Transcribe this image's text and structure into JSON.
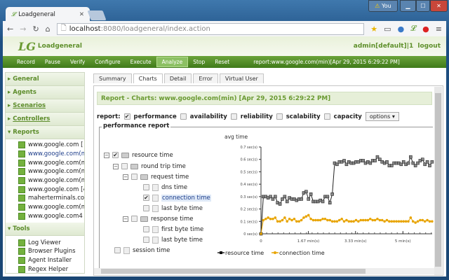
{
  "browser": {
    "tab_title": "Loadgeneral",
    "url_host": "localhost",
    "url_rest": ":8080/loadgeneral/index.action",
    "user_badge": "You"
  },
  "app": {
    "logo_text": "Loadgeneral",
    "user": "admin[default]|1",
    "logout": "logout"
  },
  "nav": {
    "items": [
      "Record",
      "Pause",
      "Verify",
      "Configure",
      "Execute",
      "Analyze",
      "Stop",
      "Reset"
    ],
    "active": "Analyze",
    "info": "report:www.google.com(min)[Apr 29, 2015 6:29:22 PM]"
  },
  "sidebar": {
    "sections": [
      {
        "label": "General"
      },
      {
        "label": "Agents"
      },
      {
        "label": "Scenarios"
      },
      {
        "label": "Controllers"
      },
      {
        "label": "Reports"
      },
      {
        "label": "Tools"
      }
    ],
    "reports": [
      "www.google.com [",
      "www.google.com(m",
      "www.google.com(m",
      "www.google.com(m",
      "www.google.com(m",
      "www.google.com [4",
      "maherterminals.co",
      "www.google.com(m",
      "www.google.com4"
    ],
    "tools": [
      "Log Viewer",
      "Browser Plugins",
      "Agent Installer",
      "Regex Helper"
    ]
  },
  "tabs": [
    "Summary",
    "Charts",
    "Detail",
    "Error",
    "Virtual User"
  ],
  "report_header": "Report - Charts: www.google.com(min) [Apr 29, 2015 6:29:22 PM]",
  "report_row": {
    "label": "report:",
    "types": [
      {
        "label": "performance",
        "checked": true
      },
      {
        "label": "availability",
        "checked": false
      },
      {
        "label": "reliability",
        "checked": false
      },
      {
        "label": "scalability",
        "checked": false
      },
      {
        "label": "capacity",
        "checked": false
      }
    ],
    "options": "options ▾"
  },
  "fieldset_label": "performance report",
  "tree": [
    "resource time",
    "round trip time",
    "request time",
    "dns time",
    "connection time",
    "last byte time",
    "response time",
    "first byte time",
    "last byte time",
    "session time"
  ],
  "chart_data": {
    "type": "line",
    "title": "avg time",
    "xlabel": "min(s)",
    "ylabel": "sec(s)",
    "xlim": [
      0,
      6.03
    ],
    "ylim": [
      0,
      0.7
    ],
    "x_ticks": [
      "0",
      "1.67 min(s)",
      "3.33 min(s)",
      "5 min(s)"
    ],
    "x_tick_values": [
      0,
      1.67,
      3.33,
      5
    ],
    "y_ticks": [
      "0 sec(s)",
      "0.1 sec(s)",
      "0.2 sec(s)",
      "0.3 sec(s)",
      "0.4 sec(s)",
      "0.5 sec(s)",
      "0.6 sec(s)",
      "0.7 sec(s)"
    ],
    "x_step": 0.0837,
    "legend": "bottom",
    "series": [
      {
        "name": "resource time",
        "color": "#222222",
        "marker_color": "#888888",
        "values": [
          0,
          0.3,
          0.3,
          0.29,
          0.3,
          0.28,
          0.3,
          0.25,
          0.24,
          0.28,
          0.3,
          0.26,
          0.29,
          0.28,
          0.28,
          0.27,
          0.28,
          0.28,
          0.33,
          0.34,
          0.28,
          0.32,
          0.26,
          0.26,
          0.26,
          0.27,
          0.26,
          0.3,
          0.3,
          0.25,
          0.32,
          0.57,
          0.56,
          0.58,
          0.58,
          0.59,
          0.56,
          0.58,
          0.57,
          0.57,
          0.58,
          0.58,
          0.59,
          0.59,
          0.57,
          0.58,
          0.57,
          0.59,
          0.59,
          0.62,
          0.6,
          0.58,
          0.57,
          0.58,
          0.55,
          0.55,
          0.57,
          0.57,
          0.57,
          0.56,
          0.58,
          0.56,
          0.57,
          0.62,
          0.57,
          0.55,
          0.57,
          0.59,
          0.6,
          0.56,
          0.58,
          0.55,
          0.58
        ]
      },
      {
        "name": "connection time",
        "color": "#e8a400",
        "marker_color": "#e8a400",
        "values": [
          0,
          0.11,
          0.12,
          0.13,
          0.12,
          0.12,
          0.13,
          0.1,
          0.1,
          0.11,
          0.13,
          0.1,
          0.12,
          0.11,
          0.12,
          0.1,
          0.1,
          0.11,
          0.13,
          0.14,
          0.15,
          0.12,
          0.11,
          0.11,
          0.11,
          0.11,
          0.12,
          0.12,
          0.11,
          0.11,
          0.1,
          0.1,
          0.1,
          0.11,
          0.12,
          0.1,
          0.11,
          0.1,
          0.1,
          0.1,
          0.11,
          0.1,
          0.11,
          0.11,
          0.11,
          0.11,
          0.12,
          0.11,
          0.11,
          0.12,
          0.11,
          0.11,
          0.1,
          0.11,
          0.1,
          0.1,
          0.1,
          0.1,
          0.1,
          0.1,
          0.1,
          0.1,
          0.1,
          0.13,
          0.1,
          0.09,
          0.1,
          0.11,
          0.11,
          0.1,
          0.11,
          0.1,
          0.1
        ]
      }
    ]
  }
}
